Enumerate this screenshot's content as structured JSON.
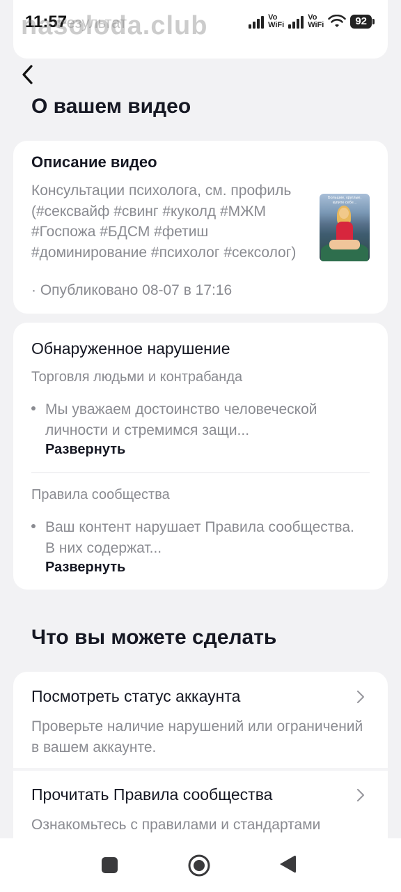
{
  "status_bar": {
    "time": "11:57",
    "ghost_text": "Результат",
    "watermark": "nasolodа.club",
    "vowifi_1": "Vo\nWiFi",
    "vowifi_2": "Vo\nWiFi",
    "battery": "92"
  },
  "header": {
    "title": "О вашем видео"
  },
  "video_description": {
    "heading": "Описание видео",
    "text": "Консультации психолога, см. профиль (#сексвайф #свинг #куколд #МЖМ #Госпожа #БДСМ #фетиш #доминирование #психолог #сексолог)",
    "published": "· Опубликовано 08-07 в 17:16",
    "thumbnail_caption": "Большие, круглые, купите себе..."
  },
  "violation": {
    "heading": "Обнаруженное нарушение",
    "category": "Торговля людьми и контрабанда",
    "category_text": "Мы уважаем достоинство человеческой личности и стремимся защи...",
    "expand_label_1": "Развернуть",
    "rules_label": "Правила сообщества",
    "rules_text": "Ваш контент нарушает Правила сообщества. В них содержат...",
    "expand_label_2": "Развернуть"
  },
  "actions": {
    "section_title": "Что вы можете сделать",
    "items": [
      {
        "title": "Посмотреть статус аккаунта",
        "description": "Проверьте наличие нарушений или ограничений в вашем аккаунте."
      },
      {
        "title": "Прочитать Правила сообщества",
        "description": "Ознакомьтесь с правилами и стандартами"
      }
    ]
  },
  "icons": {
    "back": "chevron-left-icon",
    "chevron": "chevron-right-icon",
    "nav_recents": "square-icon",
    "nav_home": "circle-icon",
    "nav_back": "triangle-back-icon"
  },
  "colors": {
    "background": "#f2f2f4",
    "card": "#ffffff",
    "text_primary": "#161823",
    "text_muted": "#8a8b91"
  }
}
